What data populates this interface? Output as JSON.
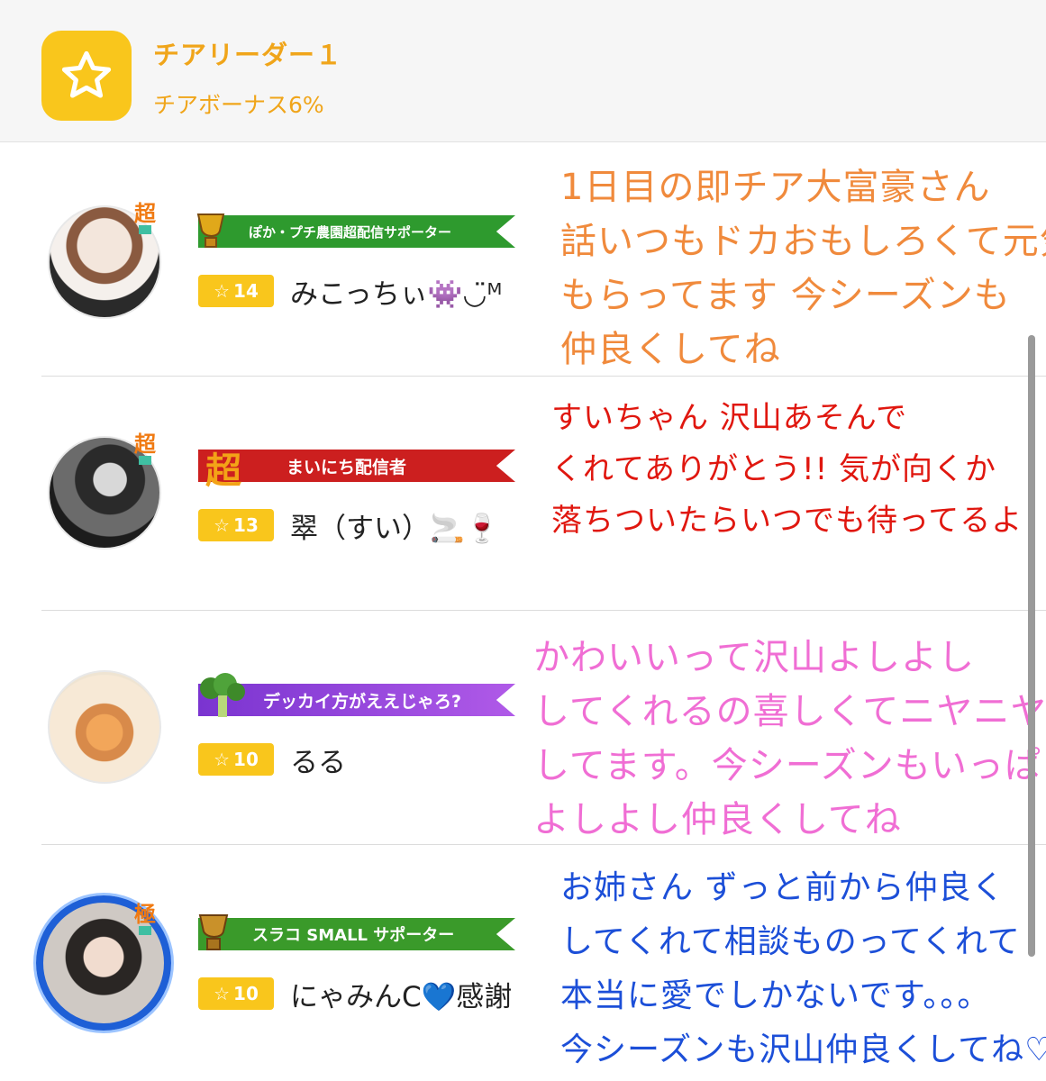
{
  "header": {
    "icon": "star-icon",
    "title": "チアリーダー１",
    "subtitle": "チアボーナス6%"
  },
  "rows": [
    {
      "grade": "超",
      "banner": "ぽか・プチ農園超配信サポーター",
      "banner_color": "#2e9a2e",
      "stars": "14",
      "name": "みこっちぃ👾◡̈ᴹ",
      "note": "1日目の即チア大富豪さん\n話いつもドカおもしろくて元気\nもらってます 今シーズンも\n仲良くしてね",
      "note_color": "#f08a3c"
    },
    {
      "grade": "超",
      "banner": "まいにち配信者",
      "banner_color": "#cc1f1f",
      "stars": "13",
      "name": "翠（すい）🚬🍷",
      "note": "すいちゃん 沢山あそんで\nくれてありがとう!! 気が向くか\n落ちついたらいつでも待ってるよ",
      "note_color": "#e0170f"
    },
    {
      "grade": "",
      "banner": "デッカイ方がええじゃろ?",
      "banner_color": "#8a3cd6",
      "stars": "10",
      "name": "るる",
      "note": "かわいいって沢山よしよし\nしてくれるの喜しくてニヤニヤ\nしてます。今シーズンもいっぱい\nよしよし仲良くしてね",
      "note_color": "#f06ed4"
    },
    {
      "grade": "極",
      "banner": "スラコ SMALL サポーター",
      "banner_color": "#3a9a2a",
      "stars": "10",
      "name": "にゃみんC💙感謝",
      "note": "お姉さん ずっと前から仲良く\nしてくれて相談ものってくれて\n本当に愛でしかないです。。。\n今シーズンも沢山仲良くしてね♡♡",
      "note_color": "#1c4fd8"
    }
  ]
}
